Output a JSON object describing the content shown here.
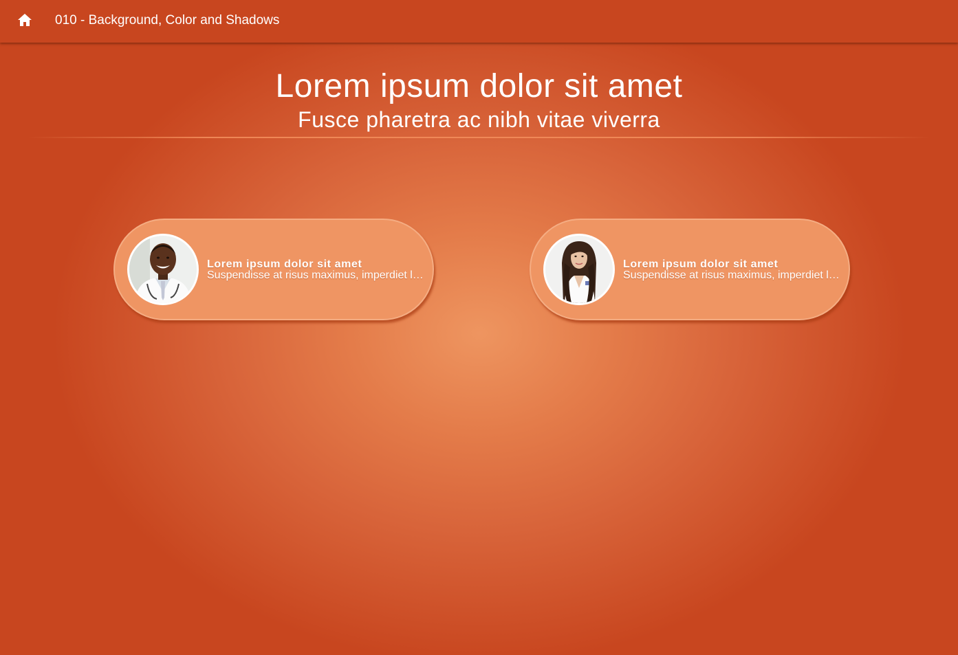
{
  "topbar": {
    "home_icon": "home-icon",
    "title": "010 - Background, Color and Shadows"
  },
  "hero": {
    "title": "Lorem ipsum dolor sit amet",
    "subtitle": "Fusce pharetra ac nibh vitae viverra"
  },
  "cards": [
    {
      "avatar": "doctor-man-photo",
      "title": "Lorem ipsum dolor sit amet",
      "text": "Suspendisse at risus maximus, imperdiet lorem"
    },
    {
      "avatar": "doctor-woman-photo",
      "title": "Lorem ipsum dolor sit amet",
      "text": "Suspendisse at risus maximus, imperdiet lorem"
    }
  ],
  "colors": {
    "background": "#c7451f",
    "glow": "#ee9560",
    "card": "#ef9563",
    "text": "#ffffff"
  }
}
